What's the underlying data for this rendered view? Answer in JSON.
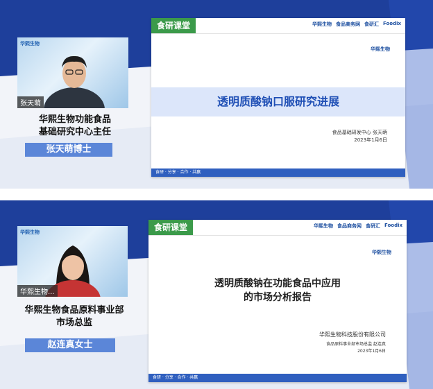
{
  "top": {
    "camera": {
      "name_tag": "张天萌",
      "logo": "华熙生物"
    },
    "caption_line1": "华熙生物功能食品",
    "caption_line2": "基础研究中心主任",
    "name_bar": "张天萌博士",
    "slide": {
      "brand": "食研课堂",
      "partners": [
        "华熙生物",
        "食品商务网",
        "食研汇",
        "Foodix"
      ],
      "logo": "华熙生物",
      "title": "透明质酸钠口服研究进展",
      "presenter": "食品基础研发中心 张天萌",
      "date": "2023年1月6日",
      "footer": "食研 · 分享 · 合作 · 共赢"
    }
  },
  "bottom": {
    "camera": {
      "name_tag": "华熙生物...",
      "logo": "华熙生物"
    },
    "caption_line1": "华熙生物食品原料事业部",
    "caption_line2": "市场总监",
    "name_bar": "赵连真女士",
    "slide": {
      "brand": "食研课堂",
      "partners": [
        "华熙生物",
        "食品商务网",
        "食研汇",
        "Foodix"
      ],
      "logo": "华熙生物",
      "title_line1": "透明质酸钠在功能食品中应用",
      "title_line2": "的市场分析报告",
      "company": "华熙生物科技股份有限公司",
      "presenter": "食品原料事业部市场总监 赵连真",
      "date": "2023年1月6日",
      "footer": "食研 · 分享 · 合作 · 共赢"
    }
  },
  "colors": {
    "accent_blue": "#1f4fb5",
    "brand_green": "#3b9a4a",
    "name_bar": "#5b86d8"
  }
}
